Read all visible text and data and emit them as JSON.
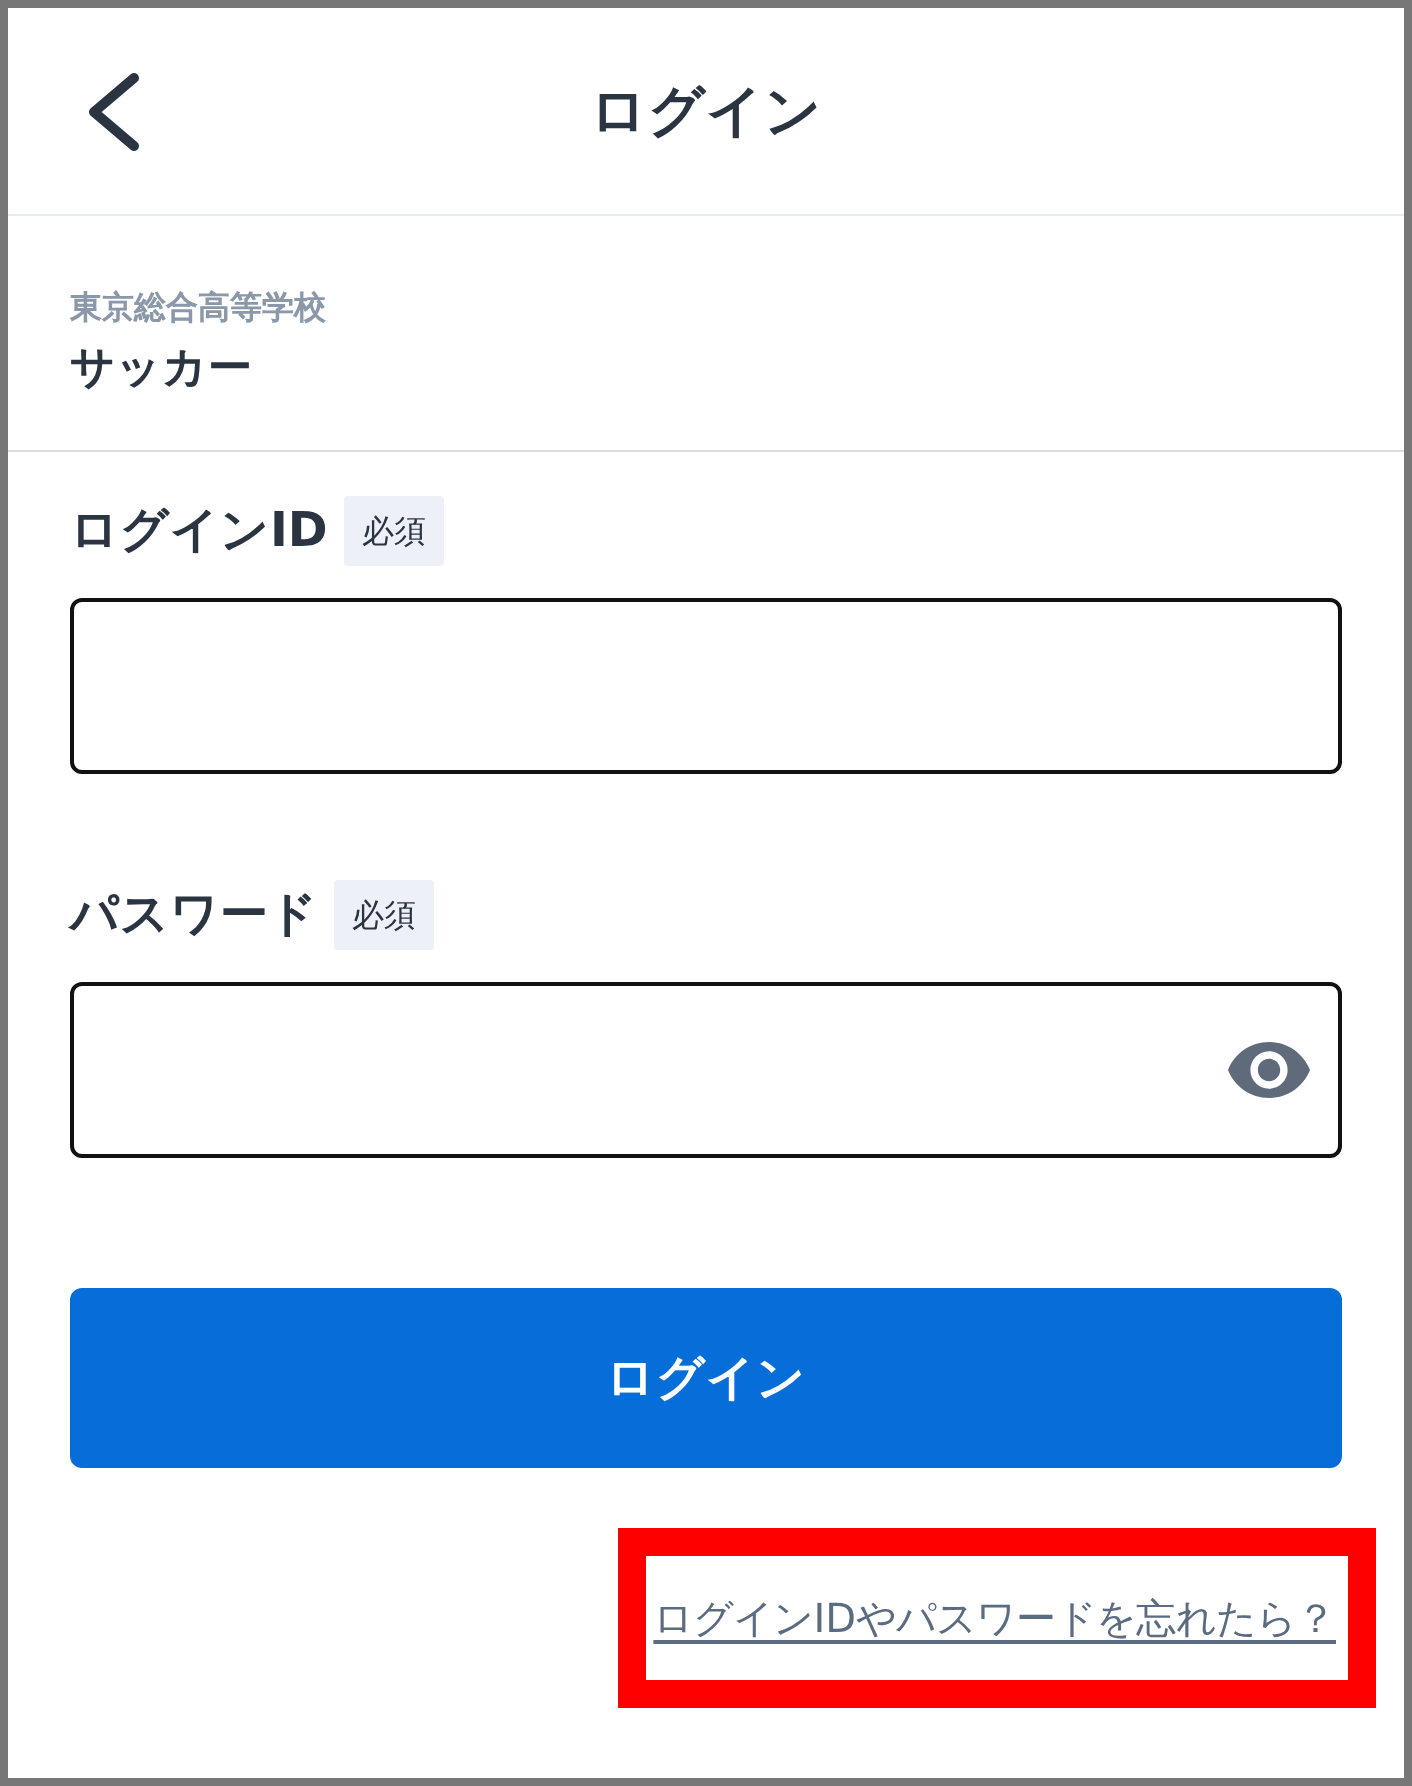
{
  "header": {
    "title": "ログイン"
  },
  "organization": {
    "school": "東京総合高等学校",
    "team": "サッカー"
  },
  "fields": [
    {
      "kind": "text",
      "label": "ログインID",
      "badge": "必須"
    },
    {
      "kind": "password",
      "label": "パスワード",
      "badge": "必須"
    }
  ],
  "login_button": {
    "label": "ログイン"
  },
  "forgot_link": {
    "text": "ログインIDやパスワードを忘れたら？",
    "highlighted": true
  }
}
